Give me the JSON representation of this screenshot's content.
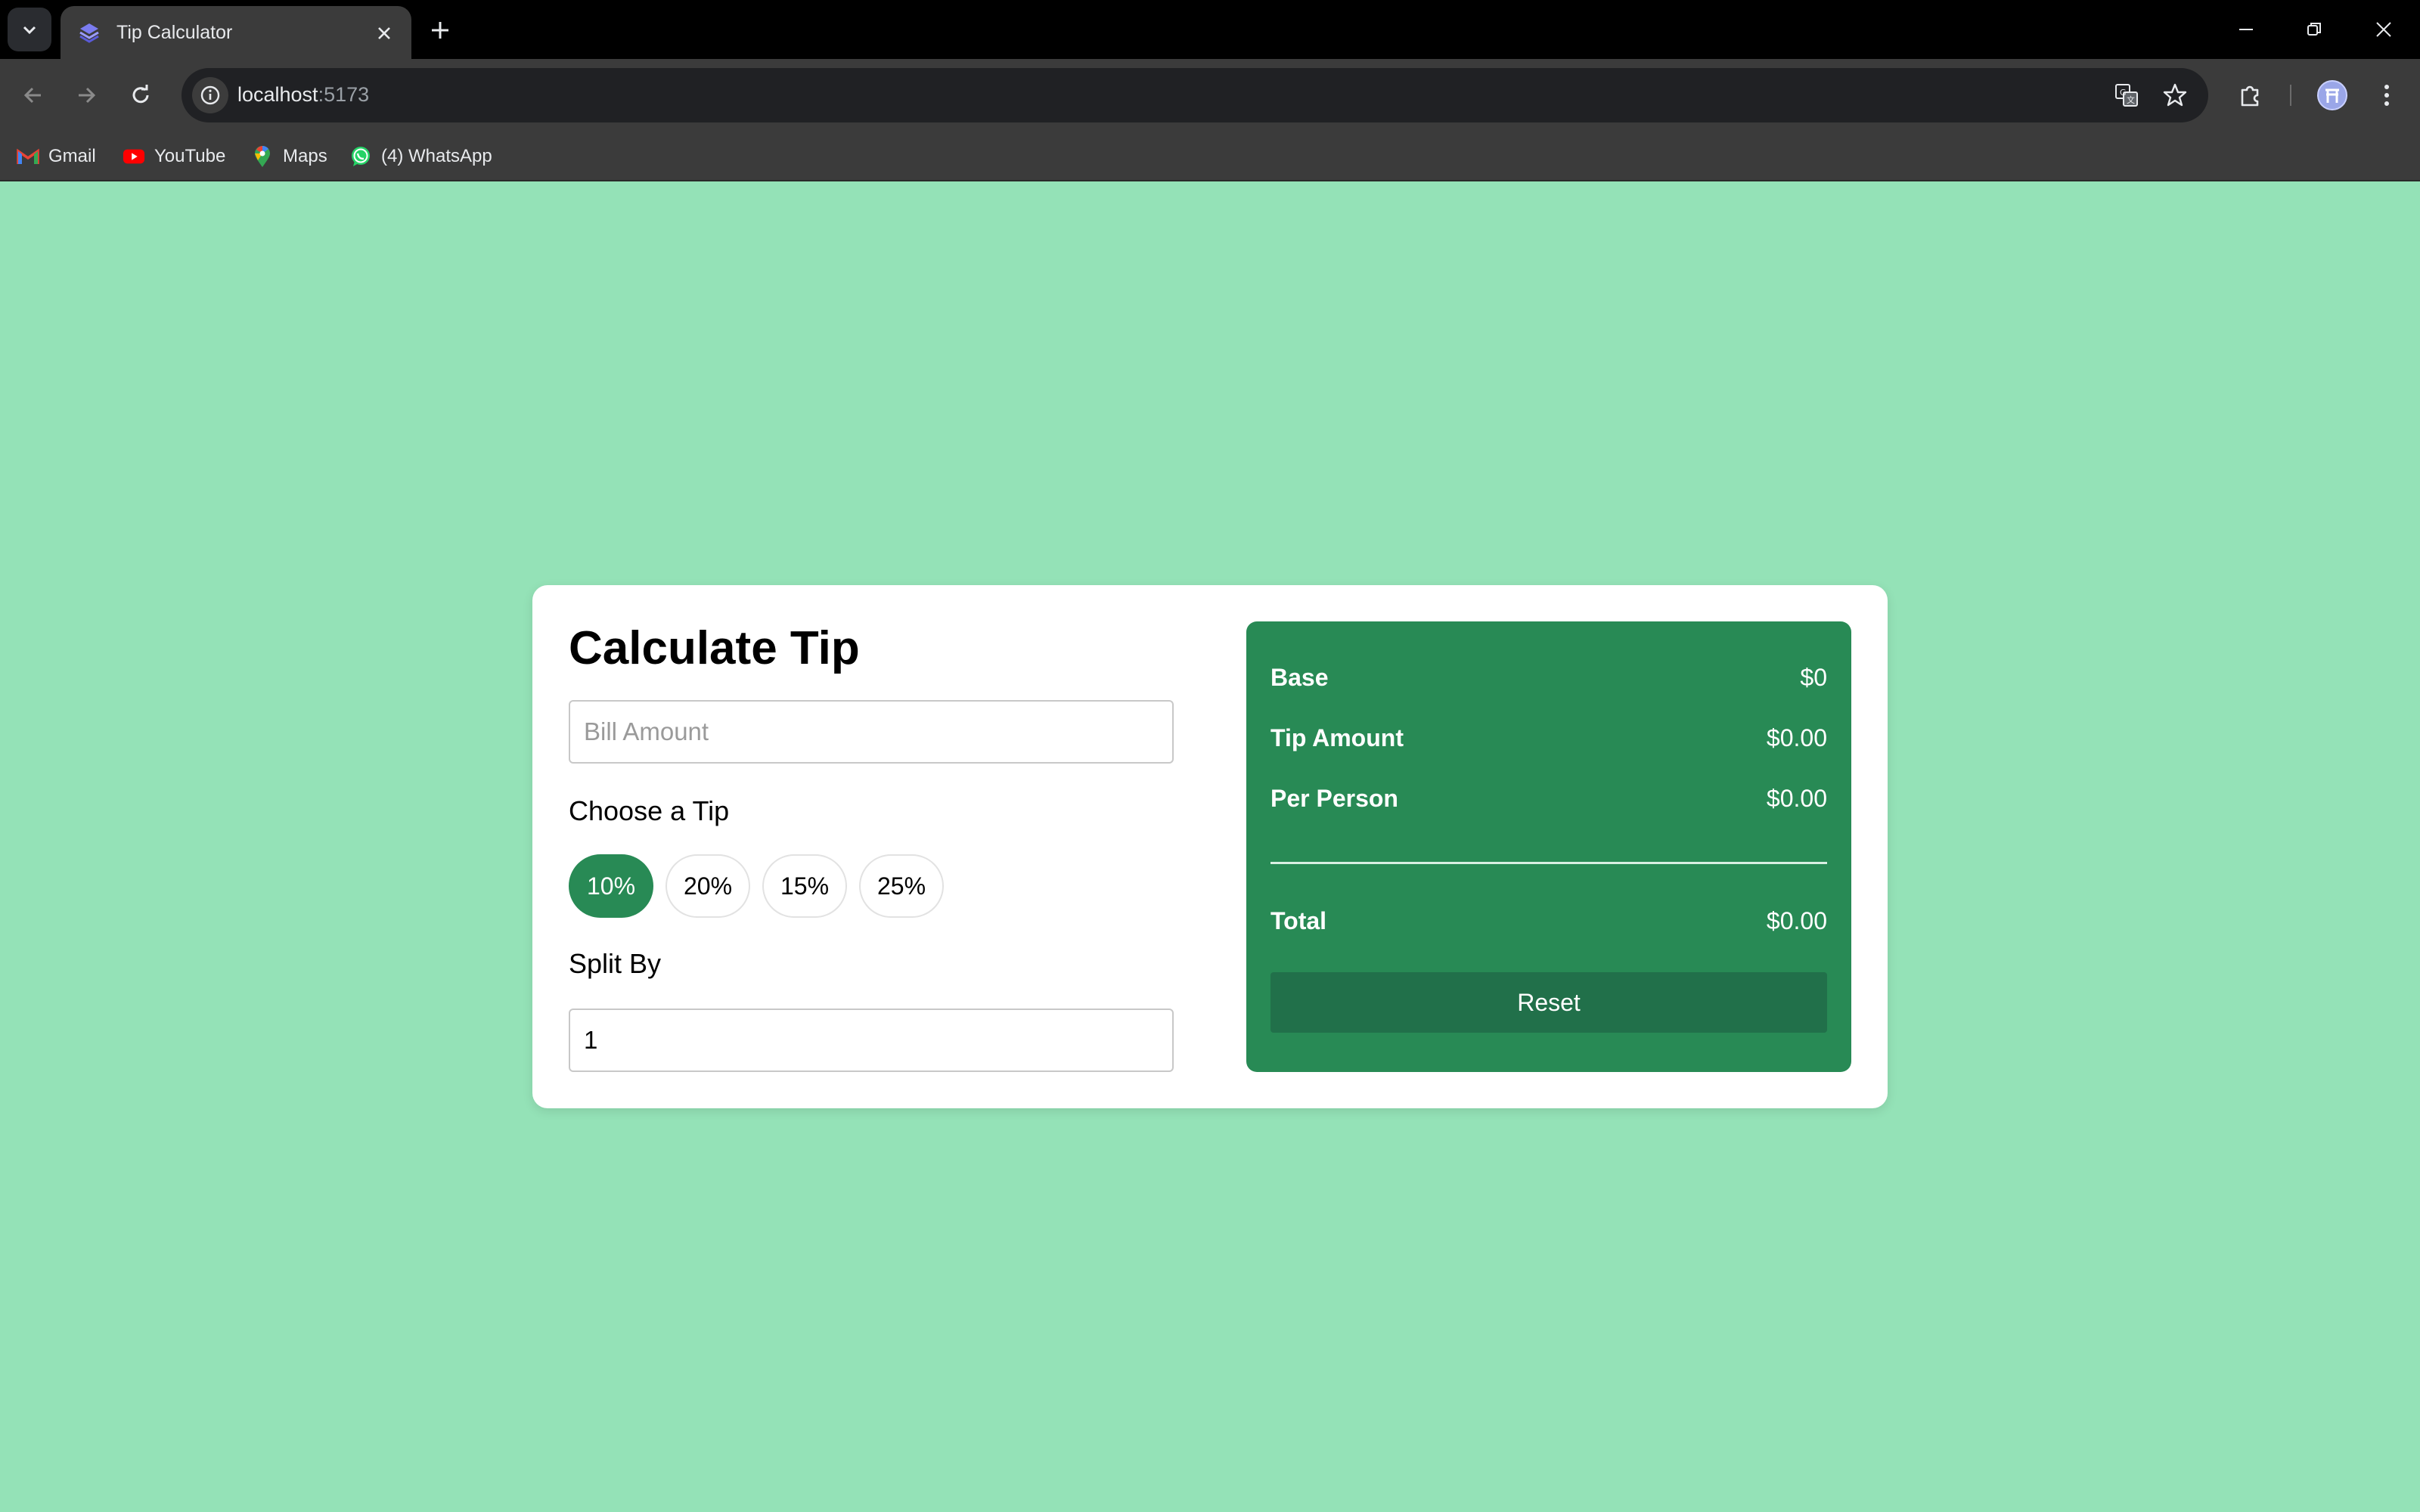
{
  "browser": {
    "tab_title": "Tip Calculator",
    "url_host": "localhost",
    "url_port": ":5173",
    "bookmarks": [
      {
        "label": "Gmail",
        "icon": "gmail-icon"
      },
      {
        "label": "YouTube",
        "icon": "youtube-icon"
      },
      {
        "label": "Maps",
        "icon": "maps-icon"
      },
      {
        "label": "(4) WhatsApp",
        "icon": "whatsapp-icon"
      }
    ]
  },
  "calculator": {
    "title": "Calculate Tip",
    "bill_placeholder": "Bill Amount",
    "bill_value": "",
    "choose_tip_label": "Choose a Tip",
    "tip_options": [
      "10%",
      "20%",
      "15%",
      "25%"
    ],
    "selected_tip": "10%",
    "split_label": "Split By",
    "split_value": "1"
  },
  "summary": {
    "base_label": "Base",
    "base_value": "$0",
    "tip_label": "Tip Amount",
    "tip_value": "$0.00",
    "per_person_label": "Per Person",
    "per_person_value": "$0.00",
    "total_label": "Total",
    "total_value": "$0.00",
    "reset_label": "Reset"
  },
  "colors": {
    "page_background": "#94e2b7",
    "accent_green": "#288a55",
    "reset_button": "#21704a"
  }
}
